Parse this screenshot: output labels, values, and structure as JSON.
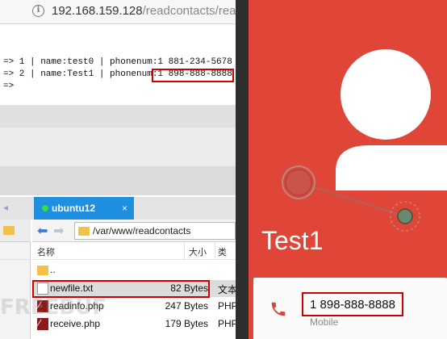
{
  "browser": {
    "url_host": "192.168.159.128",
    "url_path": "/readcontacts/rea"
  },
  "output_lines": [
    "=> 1 | name:test0 | phonenum:1 881-234-5678",
    "=> 2 | name:Test1 | phonenum:1 898-888-8888",
    "=>"
  ],
  "sftp": {
    "tab_label": "ubuntu12",
    "tab_close": "×",
    "path": "/var/www/readcontacts",
    "columns": {
      "name": "名称",
      "size": "大小",
      "type": "类"
    },
    "files": [
      {
        "name": "..",
        "size": "",
        "type": ""
      },
      {
        "name": "newfile.txt",
        "size": "82 Bytes",
        "type": "文本"
      },
      {
        "name": "readinfo.php",
        "size": "247 Bytes",
        "type": "PHP"
      },
      {
        "name": "receive.php",
        "size": "179 Bytes",
        "type": "PHP"
      }
    ]
  },
  "contact": {
    "name": "Test1",
    "phone": "1 898-888-8888",
    "phone_label": "Mobile"
  },
  "watermark": "FREEBUF",
  "colors": {
    "contact_bg": "#df4638",
    "highlight": "#d00000",
    "tab_active": "#1f8fe0"
  }
}
